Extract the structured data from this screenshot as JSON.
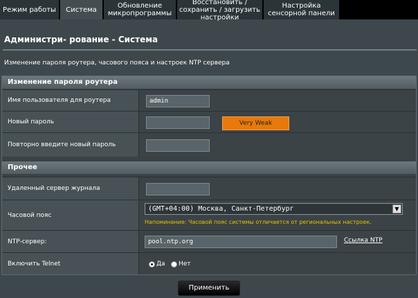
{
  "tabs": [
    {
      "label": "Режим работы"
    },
    {
      "label": "Система"
    },
    {
      "label": "Обновление микропрограммы"
    },
    {
      "label": "Восстановить / сохранить / загрузить настройки"
    },
    {
      "label": "Настройка сенсорной панели"
    }
  ],
  "page": {
    "title": "Администри- рование - Система",
    "description": "Изменение пароля роутера, часового пояса и настроек NTP сервера"
  },
  "password_section": {
    "header": "Изменение пароля роутера",
    "username_label": "Имя пользователя для роутера",
    "username_value": "admin",
    "new_password_label": "Новый пароль",
    "new_password_value": "",
    "strength": "Very Weak",
    "repeat_password_label": "Повторно введите новый пароль",
    "repeat_password_value": ""
  },
  "misc_section": {
    "header": "Прочее",
    "log_server_label": "Удаленный сервер журнала",
    "log_server_value": "",
    "timezone_label": "Часовой пояс",
    "timezone_value": "(GMT+04:00) Москва, Санкт-Петербург",
    "timezone_hint": "Напоминание: Часовой пояс системы отличается от региональных настроек.",
    "ntp_label": "NTP-сервер:",
    "ntp_value": "pool.ntp.org",
    "ntp_link": "Ссылка NTP",
    "telnet_label": "Включить Telnet",
    "telnet_yes": "Да",
    "telnet_no": "Нет",
    "telnet_selected": "yes"
  },
  "apply_label": "Применить",
  "colors": {
    "strength": "#e8790a",
    "hint": "#e6c200"
  }
}
